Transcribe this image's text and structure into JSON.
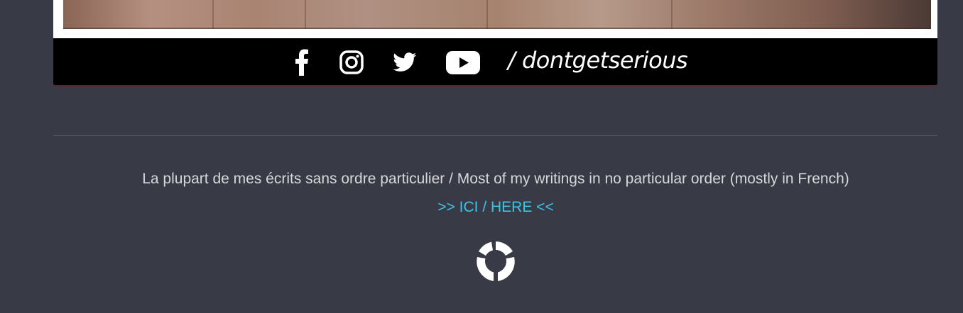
{
  "embed": {
    "social_handle": "/ dontgetserious",
    "icons": [
      "facebook-icon",
      "instagram-icon",
      "twitter-icon",
      "youtube-icon"
    ]
  },
  "footer": {
    "caption": "La plupart de mes écrits sans ordre particulier / Most of my writings in no particular order (mostly in French)",
    "link_label": ">> ICI / HERE <<"
  },
  "colors": {
    "background": "#383a45",
    "link": "#3ec2e8",
    "text": "#d6d7db"
  }
}
